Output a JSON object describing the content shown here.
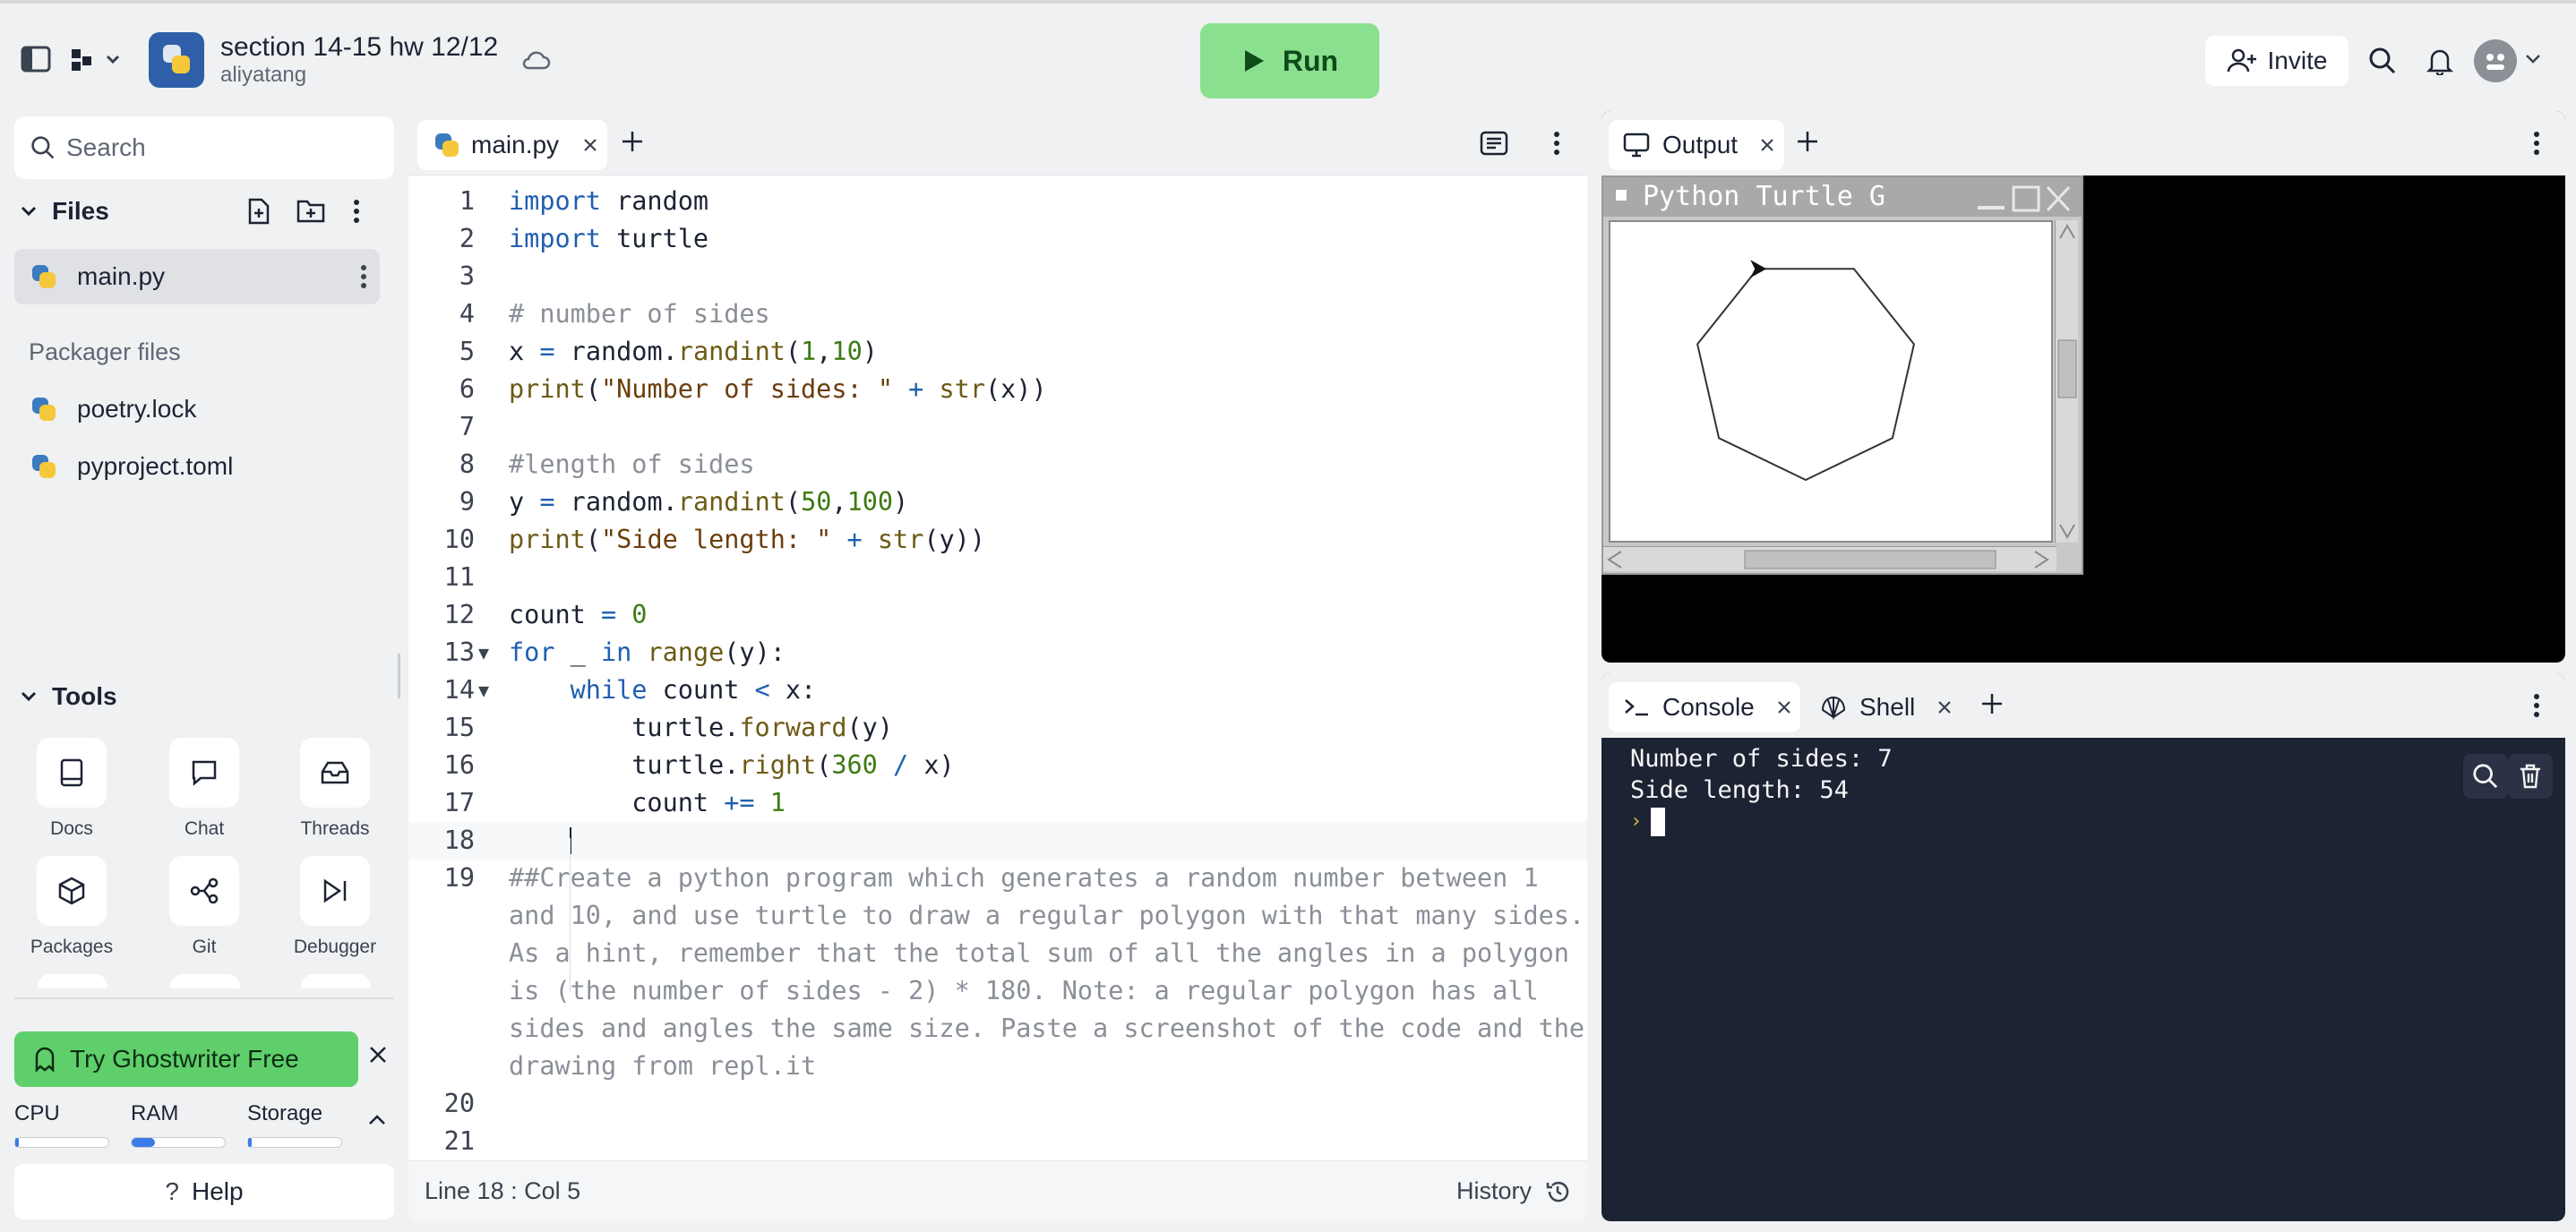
{
  "topbar": {
    "repl_title": "section 14-15 hw 12/12",
    "repl_owner": "aliyatang",
    "run_label": "Run",
    "invite_label": "Invite",
    "icons": [
      "sidebar-toggle-icon",
      "workspace-switch-icon",
      "cloud-icon",
      "search-icon",
      "bell-icon"
    ]
  },
  "sidebar": {
    "search_placeholder": "Search",
    "files_heading": "Files",
    "files": [
      {
        "name": "main.py",
        "active": true
      }
    ],
    "packager_heading": "Packager files",
    "packager_files": [
      {
        "name": "poetry.lock"
      },
      {
        "name": "pyproject.toml"
      }
    ],
    "tools_heading": "Tools",
    "tools": [
      {
        "label": "Docs",
        "icon": "docs-icon"
      },
      {
        "label": "Chat",
        "icon": "chat-icon"
      },
      {
        "label": "Threads",
        "icon": "threads-icon"
      },
      {
        "label": "Packages",
        "icon": "packages-icon"
      },
      {
        "label": "Git",
        "icon": "git-icon"
      },
      {
        "label": "Debugger",
        "icon": "debugger-icon"
      }
    ],
    "ghostwriter_label": "Try Ghostwriter Free",
    "resources": [
      {
        "label": "CPU",
        "level": 0.02
      },
      {
        "label": "RAM",
        "level": 0.25
      },
      {
        "label": "Storage",
        "level": 0.04
      }
    ],
    "help_label": "Help"
  },
  "editor": {
    "tab_label": "main.py",
    "code_lines": [
      {
        "n": "1",
        "t": "import random"
      },
      {
        "n": "2",
        "t": "import turtle"
      },
      {
        "n": "3",
        "t": ""
      },
      {
        "n": "4",
        "t": "# number of sides"
      },
      {
        "n": "5",
        "t": "x = random.randint(1,10)"
      },
      {
        "n": "6",
        "t": "print(\"Number of sides: \" + str(x))"
      },
      {
        "n": "7",
        "t": ""
      },
      {
        "n": "8",
        "t": "#length of sides"
      },
      {
        "n": "9",
        "t": "y = random.randint(50,100)"
      },
      {
        "n": "10",
        "t": "print(\"Side length: \" + str(y))"
      },
      {
        "n": "11",
        "t": ""
      },
      {
        "n": "12",
        "t": "count = 0"
      },
      {
        "n": "13",
        "t": "for _ in range(y):"
      },
      {
        "n": "14",
        "t": "    while count < x:"
      },
      {
        "n": "15",
        "t": "        turtle.forward(y)"
      },
      {
        "n": "16",
        "t": "        turtle.right(360 / x)"
      },
      {
        "n": "17",
        "t": "        count += 1"
      },
      {
        "n": "18",
        "t": ""
      },
      {
        "n": "19",
        "t": "##Create a python program which generates a random number between 1"
      },
      {
        "n": "",
        "t": "and 10, and use turtle to draw a regular polygon with that many sides."
      },
      {
        "n": "",
        "t": "As a hint, remember that the total sum of all the angles in a polygon"
      },
      {
        "n": "",
        "t": "is (the number of sides - 2) * 180. Note: a regular polygon has all"
      },
      {
        "n": "",
        "t": "sides and angles the same size. Paste a screenshot of the code and the"
      },
      {
        "n": "",
        "t": "drawing from repl.it"
      },
      {
        "n": "20",
        "t": ""
      },
      {
        "n": "21",
        "t": ""
      }
    ],
    "cursor_position": "Line 18 : Col 5",
    "history_label": "History"
  },
  "output": {
    "tab_label": "Output",
    "turtle_window_title": "Python Turtle G",
    "polygon_sides": 7
  },
  "console": {
    "tab_console_label": "Console",
    "tab_shell_label": "Shell",
    "lines": [
      "Number of sides: 7",
      "Side length: 54"
    ]
  }
}
